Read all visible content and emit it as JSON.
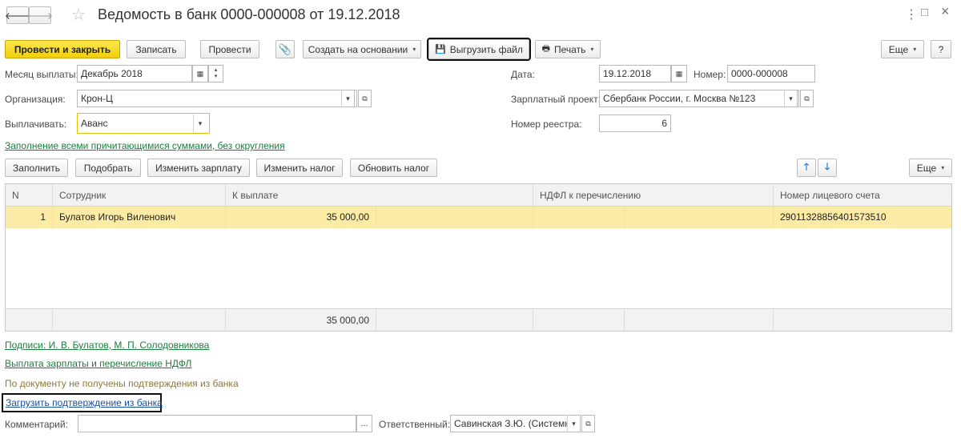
{
  "title": "Ведомость в банк 0000-000008 от 19.12.2018",
  "nav": {
    "back_icon": "arrow-left-icon",
    "forward_icon": "arrow-right-icon",
    "star_icon": "star-icon"
  },
  "window_controls": {
    "more": "⋮",
    "maximize": "□",
    "close": "×"
  },
  "toolbar": {
    "post_close": "Провести и закрыть",
    "save": "Записать",
    "post": "Провести",
    "create_based": "Создать на основании",
    "upload_file": "Выгрузить файл",
    "print": "Печать",
    "more": "Еще",
    "help": "?"
  },
  "fields": {
    "month_label": "Месяц выплаты:",
    "month_value": "Декабрь 2018",
    "org_label": "Организация:",
    "org_value": "Крон-Ц",
    "pay_label": "Выплачивать:",
    "pay_value": "Аванс",
    "date_label": "Дата:",
    "date_value": "19.12.2018",
    "number_label": "Номер:",
    "number_value": "0000-000008",
    "salary_project_label": "Зарплатный проект:",
    "salary_project_value": "Сбербанк России, г. Москва №123",
    "registry_label": "Номер реестра:",
    "registry_value": "6"
  },
  "fill_link": "Заполнение всеми причитающимися суммами, без округления",
  "table_toolbar": {
    "fill": "Заполнить",
    "pick": "Подобрать",
    "change_salary": "Изменить зарплату",
    "change_tax": "Изменить налог",
    "update_tax": "Обновить налог",
    "more": "Еще"
  },
  "table": {
    "headers": [
      "N",
      "Сотрудник",
      "К выплате",
      "НДФЛ к перечислению",
      "Номер лицевого счета"
    ],
    "rows": [
      {
        "n": "1",
        "employee": "Булатов Игорь Виленович",
        "amount": "35 000,00",
        "ndfl": "",
        "account": "29011328856401573510"
      }
    ],
    "total_amount": "35 000,00"
  },
  "signatures_link": "Подписи: И. В. Булатов, М. П. Солодовникова",
  "payment_link": "Выплата зарплаты и перечисление НДФЛ",
  "status_text": "По документу не получены подтверждения из банка",
  "load_confirmation_link": "Загрузить подтверждение из банка",
  "comment_label": "Комментарий:",
  "comment_value": "",
  "responsible_label": "Ответственный:",
  "responsible_value": "Савинская З.Ю. (Системн",
  "colors": {
    "primary": "#f5d81f",
    "link_green": "#1a7f3c",
    "link_blue": "#1b4fa0",
    "row_selected": "#fbeba4"
  }
}
